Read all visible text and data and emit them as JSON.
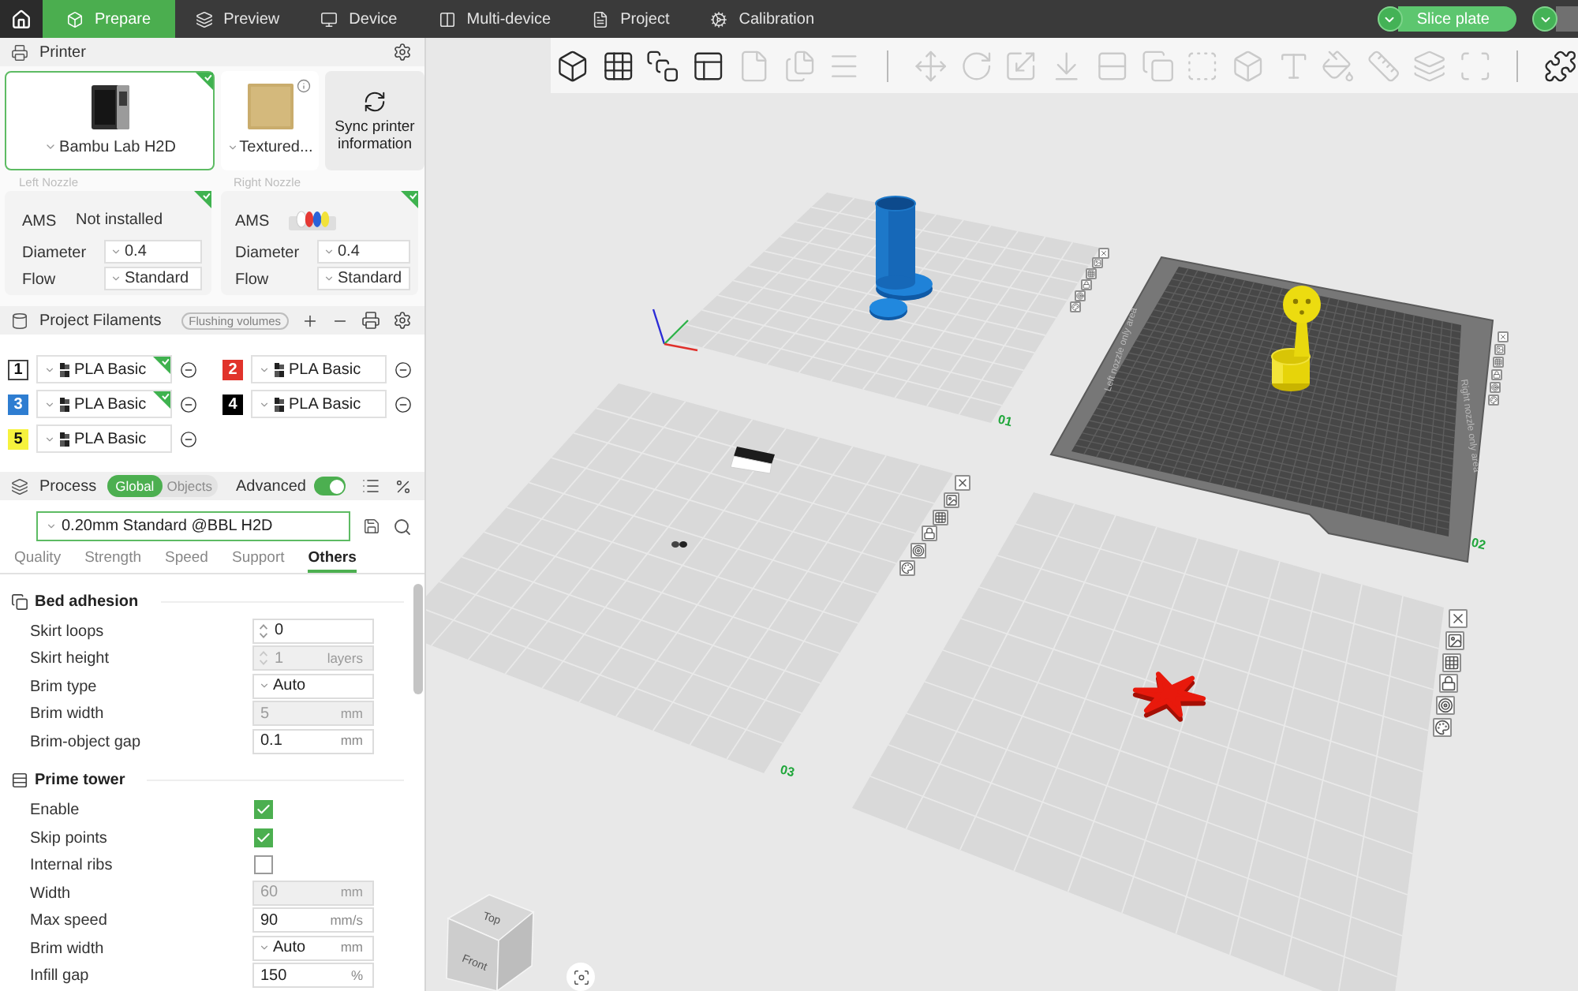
{
  "top_bar": {
    "tabs": [
      {
        "label": "Prepare",
        "selected": true
      },
      {
        "label": "Preview",
        "selected": false
      },
      {
        "label": "Device",
        "selected": false
      },
      {
        "label": "Multi-device",
        "selected": false
      },
      {
        "label": "Project",
        "selected": false
      },
      {
        "label": "Calibration",
        "selected": false
      }
    ],
    "slice_button": "Slice plate"
  },
  "printer_panel": {
    "title": "Printer",
    "printer": {
      "name": "Bambu Lab H2D",
      "selected": true,
      "synced": true
    },
    "plate_type": {
      "name": "Textured..."
    },
    "sync_button": "Sync printer information",
    "nozzles": [
      {
        "caption": "Left Nozzle",
        "ams_label": "AMS",
        "ams_installed": false,
        "ams_status": "Not installed",
        "diameter_label": "Diameter",
        "diameter": "0.4",
        "flow_label": "Flow",
        "flow": "Standard",
        "synced": true
      },
      {
        "caption": "Right Nozzle",
        "ams_label": "AMS",
        "ams_installed": true,
        "diameter_label": "Diameter",
        "diameter": "0.4",
        "flow_label": "Flow",
        "flow": "Standard",
        "synced": true
      }
    ]
  },
  "filaments_panel": {
    "title": "Project Filaments",
    "flushing_button": "Flushing volumes",
    "filaments": [
      {
        "number": "1",
        "color": "#ffffff",
        "name": "PLA Basic",
        "synced": true
      },
      {
        "number": "2",
        "color": "#e1332b",
        "name": "PLA Basic",
        "synced": false
      },
      {
        "number": "3",
        "color": "#2e7dd1",
        "name": "PLA Basic",
        "synced": true
      },
      {
        "number": "4",
        "color": "#000000",
        "name": "PLA Basic",
        "synced": false
      },
      {
        "number": "5",
        "color": "#f6f23d",
        "name": "PLA Basic",
        "synced": false
      }
    ]
  },
  "process_panel": {
    "title": "Process",
    "scope": [
      {
        "label": "Global",
        "selected": true
      },
      {
        "label": "Objects",
        "selected": false
      }
    ],
    "advanced": {
      "label": "Advanced",
      "on": true
    },
    "preset": "0.20mm Standard @BBL H2D",
    "tabs": [
      {
        "label": "Quality",
        "selected": false
      },
      {
        "label": "Strength",
        "selected": false
      },
      {
        "label": "Speed",
        "selected": false
      },
      {
        "label": "Support",
        "selected": false
      },
      {
        "label": "Others",
        "selected": true
      }
    ],
    "groups": [
      {
        "title": "Bed adhesion",
        "rows": [
          {
            "label": "Skirt loops",
            "kind": "spin",
            "value": "0",
            "disabled": false
          },
          {
            "label": "Skirt height",
            "kind": "spin",
            "value": "1",
            "unit": "layers",
            "disabled": true
          },
          {
            "label": "Brim type",
            "kind": "select",
            "value": "Auto",
            "disabled": false
          },
          {
            "label": "Brim width",
            "kind": "number",
            "value": "5",
            "unit": "mm",
            "disabled": true
          },
          {
            "label": "Brim-object gap",
            "kind": "number",
            "value": "0.1",
            "unit": "mm",
            "disabled": false
          }
        ]
      },
      {
        "title": "Prime tower",
        "rows": [
          {
            "label": "Enable",
            "kind": "checkbox",
            "checked": true,
            "disabled": false
          },
          {
            "label": "Skip points",
            "kind": "checkbox",
            "checked": true,
            "disabled": false
          },
          {
            "label": "Internal ribs",
            "kind": "checkbox",
            "checked": false,
            "disabled": false
          },
          {
            "label": "Width",
            "kind": "number",
            "value": "60",
            "unit": "mm",
            "disabled": true
          },
          {
            "label": "Max speed",
            "kind": "number",
            "value": "90",
            "unit": "mm/s",
            "disabled": false
          },
          {
            "label": "Brim width",
            "kind": "select",
            "value": "Auto",
            "unit": "mm",
            "disabled": false
          },
          {
            "label": "Infill gap",
            "kind": "number",
            "value": "150",
            "unit": "%",
            "disabled": false
          }
        ]
      }
    ]
  },
  "toolbar": {
    "groups": [
      {
        "tools": [
          {
            "disabled": false
          },
          {
            "disabled": false
          },
          {
            "disabled": false
          },
          {
            "disabled": false
          },
          {
            "disabled": true
          },
          {
            "disabled": true
          },
          {
            "disabled": true
          }
        ]
      },
      {
        "tools": [
          {
            "disabled": true
          },
          {
            "disabled": true
          },
          {
            "disabled": true
          },
          {
            "disabled": true
          },
          {
            "disabled": true
          },
          {
            "disabled": true
          },
          {
            "disabled": true
          },
          {
            "disabled": true
          },
          {
            "disabled": true
          },
          {
            "disabled": true
          },
          {
            "disabled": true
          },
          {
            "disabled": true
          },
          {
            "disabled": true
          }
        ]
      },
      {
        "tools": [
          {
            "disabled": false
          }
        ]
      }
    ]
  },
  "viewport": {
    "plates": [
      {
        "label": "01",
        "selected": false
      },
      {
        "label": "02",
        "selected": true,
        "zone_labels": [
          "Left nozzle only area",
          "Right nozzle only area"
        ]
      },
      {
        "label": "03",
        "selected": false
      },
      {
        "selected": false
      }
    ],
    "view_cube": {
      "top": "Top",
      "front": "Front"
    }
  }
}
